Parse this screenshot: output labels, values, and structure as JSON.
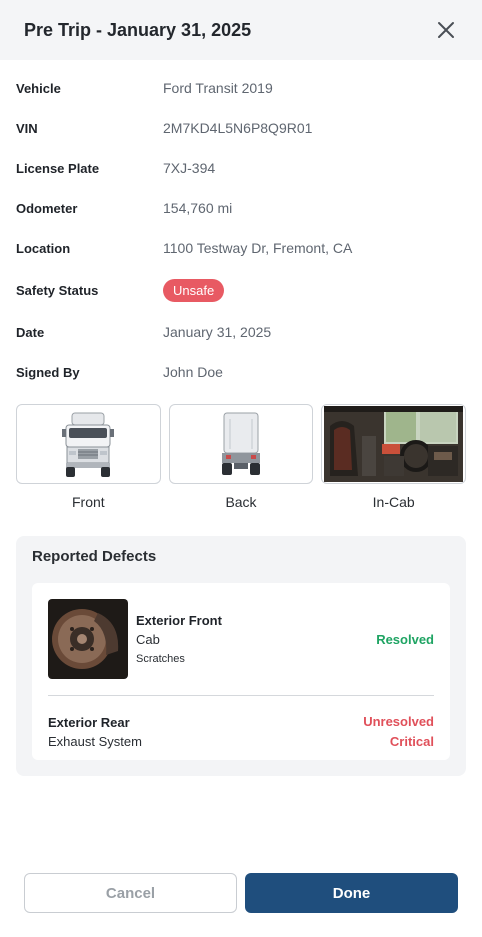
{
  "header": {
    "title": "Pre Trip - January 31, 2025"
  },
  "fields": [
    {
      "label": "Vehicle",
      "value": "Ford Transit 2019"
    },
    {
      "label": "VIN",
      "value": "2M7KD4L5N6P8Q9R01"
    },
    {
      "label": "License Plate",
      "value": "7XJ-394"
    },
    {
      "label": "Odometer",
      "value": "154,760 mi"
    },
    {
      "label": "Location",
      "value": "1100 Testway Dr, Fremont, CA"
    },
    {
      "label": "Safety Status",
      "value": "Unsafe"
    },
    {
      "label": "Date",
      "value": "January 31, 2025"
    },
    {
      "label": "Signed By",
      "value": "John Doe"
    }
  ],
  "photos": [
    {
      "label": "Front"
    },
    {
      "label": "Back"
    },
    {
      "label": "In-Cab"
    }
  ],
  "defects": {
    "title": "Reported Defects",
    "items": [
      {
        "title": "Exterior Front",
        "component": "Cab",
        "note": "Scratches",
        "status": "Resolved"
      },
      {
        "title": "Exterior Rear",
        "component": "Exhaust System",
        "status": "Unresolved",
        "severity": "Critical"
      }
    ]
  },
  "footer": {
    "cancel_label": "Cancel",
    "done_label": "Done"
  },
  "colors": {
    "unsafe": "#e85a63",
    "resolved": "#1fa463",
    "unresolved": "#e0505a",
    "primary": "#1f4e7d"
  }
}
